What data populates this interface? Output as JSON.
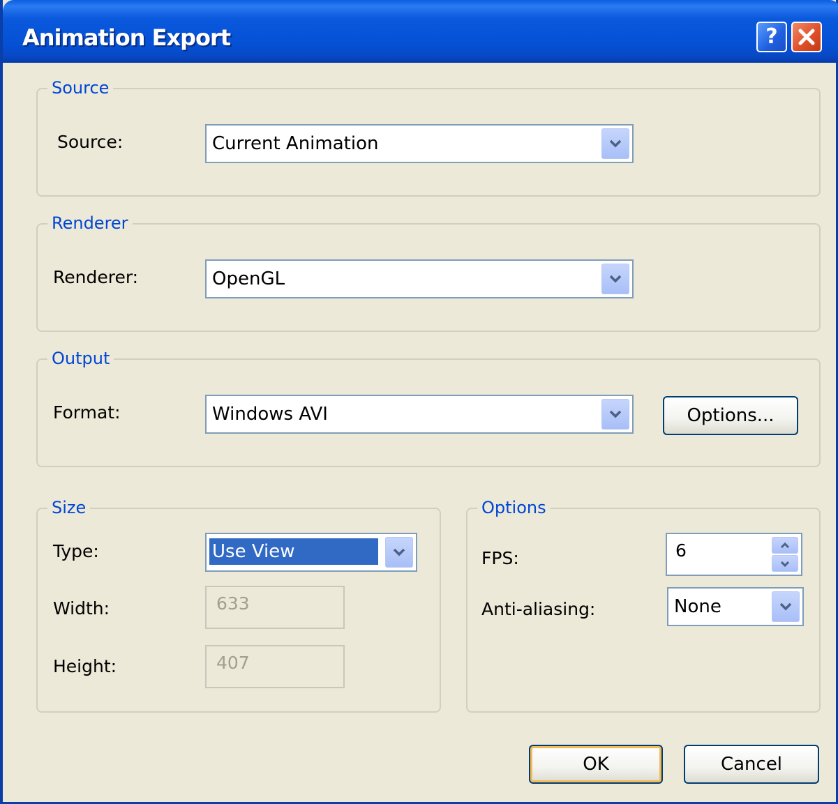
{
  "window": {
    "title": "Animation Export",
    "help_button": "?",
    "colors": {
      "titlebar": "#0551d6",
      "accent": "#0046d5",
      "face": "#ece9d8",
      "close": "#e0502a"
    }
  },
  "source_group": {
    "legend": "Source",
    "source_label": "Source:",
    "source_value": "Current Animation"
  },
  "renderer_group": {
    "legend": "Renderer",
    "renderer_label": "Renderer:",
    "renderer_value": "OpenGL"
  },
  "output_group": {
    "legend": "Output",
    "format_label": "Format:",
    "format_value": "Windows AVI",
    "options_button": "Options..."
  },
  "size_group": {
    "legend": "Size",
    "type_label": "Type:",
    "type_value": "Use View",
    "width_label": "Width:",
    "width_value": "633",
    "height_label": "Height:",
    "height_value": "407"
  },
  "options_group": {
    "legend": "Options",
    "fps_label": "FPS:",
    "fps_value": "6",
    "antialiasing_label": "Anti-aliasing:",
    "antialiasing_value": "None"
  },
  "buttons": {
    "ok": "OK",
    "cancel": "Cancel"
  }
}
